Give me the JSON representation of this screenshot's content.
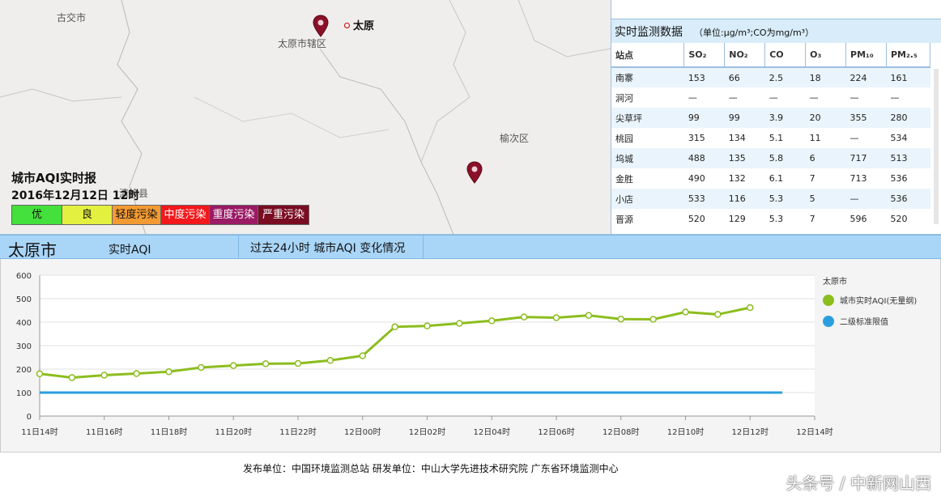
{
  "map": {
    "labels": {
      "gujiao": "古交市",
      "taiyuan_district": "太原市辖区",
      "taiyuan_city": "太原",
      "yuci": "榆次区",
      "qingxu": "清徐县"
    },
    "aqi_title": "城市AQI实时报",
    "aqi_time": "2016年12月12日 12时",
    "levels": [
      {
        "label": "优",
        "color": "#44e03c",
        "text_color": "#111"
      },
      {
        "label": "良",
        "color": "#e4f040",
        "text_color": "#111"
      },
      {
        "label": "轻度污染",
        "color": "#f39a32",
        "text_color": "#111"
      },
      {
        "label": "中度污染",
        "color": "#f2181b",
        "text_color": "#ffffff"
      },
      {
        "label": "重度污染",
        "color": "#9a1a64",
        "text_color": "#ffffff"
      },
      {
        "label": "严重污染",
        "color": "#7a0c22",
        "text_color": "#ffffff"
      }
    ]
  },
  "panel": {
    "title": "实时监测数据",
    "unit": "（单位:μg/m³;CO为mg/m³）",
    "columns": [
      "站点",
      "SO₂",
      "NO₂",
      "CO",
      "O₃",
      "PM₁₀",
      "PM₂.₅"
    ],
    "rows": [
      [
        "南寨",
        "153",
        "66",
        "2.5",
        "18",
        "224",
        "161"
      ],
      [
        "涧河",
        "—",
        "—",
        "—",
        "—",
        "—",
        "—"
      ],
      [
        "尖草坪",
        "99",
        "99",
        "3.9",
        "20",
        "355",
        "280"
      ],
      [
        "桃园",
        "315",
        "134",
        "5.1",
        "11",
        "—",
        "534"
      ],
      [
        "坞城",
        "488",
        "135",
        "5.8",
        "6",
        "717",
        "513"
      ],
      [
        "金胜",
        "490",
        "132",
        "6.1",
        "7",
        "713",
        "536"
      ],
      [
        "小店",
        "533",
        "116",
        "5.3",
        "5",
        "—",
        "536"
      ],
      [
        "晋源",
        "520",
        "129",
        "5.3",
        "7",
        "596",
        "520"
      ]
    ]
  },
  "strip": {
    "city": "太原市",
    "realtime": "实时AQI",
    "trend": "过去24小时 城市AQI 变化情况"
  },
  "chart_data": {
    "type": "line",
    "legend_title": "太原市",
    "legend_position": "right",
    "ylim": [
      0,
      600
    ],
    "yticks": [
      0,
      100,
      200,
      300,
      400,
      500,
      600
    ],
    "xlabels": [
      "11日14时",
      "11日16时",
      "11日18时",
      "11日20时",
      "11日22时",
      "12日00时",
      "12日02时",
      "12日04时",
      "12日06时",
      "12日08时",
      "12日10时",
      "12日12时",
      "12日14时"
    ],
    "x_range": [
      0,
      24
    ],
    "grid": true,
    "series": [
      {
        "name": "城市实时AQI(无量纲)",
        "color": "#8cbd1e",
        "x": [
          0,
          1,
          2,
          3,
          4,
          5,
          6,
          7,
          8,
          9,
          10,
          11,
          12,
          13,
          14,
          15,
          16,
          17,
          18,
          19,
          20,
          21,
          22
        ],
        "values": [
          180,
          164,
          174,
          181,
          189,
          207,
          215,
          223,
          224,
          237,
          257,
          380,
          384,
          395,
          406,
          422,
          419,
          429,
          413,
          412,
          443,
          433,
          462
        ]
      },
      {
        "name": "二级标准限值",
        "color": "#2a9fe0",
        "x": [
          0,
          23
        ],
        "values": [
          100,
          100
        ]
      }
    ]
  },
  "footer": {
    "text": "发布单位：中国环境监测总站    研发单位：中山大学先进技术研究院 广东省环境监测中心",
    "watermark": "头条号 / 中新网山西"
  }
}
